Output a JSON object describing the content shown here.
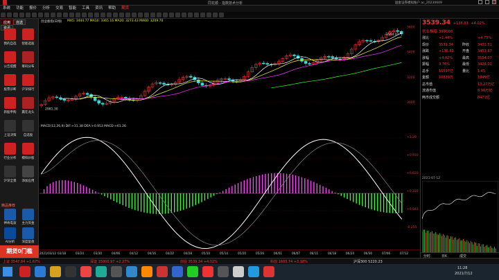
{
  "window": {
    "title": "同花顺 - 指数技术分析",
    "user": "国金证券模拟账户 ac_20230609"
  },
  "menu": {
    "items": [
      "系统",
      "功能",
      "报价",
      "分析",
      "交易",
      "智能",
      "工具",
      "资讯",
      "帮助",
      "期货"
    ]
  },
  "sidebar": {
    "tabs": [
      "应用",
      "自选",
      "资讯"
    ],
    "items": [
      {
        "label": "我的自选",
        "color": "#c22"
      },
      {
        "label": "智能选股",
        "color": "#c22"
      },
      {
        "label": "公告提醒",
        "color": "#c22"
      },
      {
        "label": "筹码分布",
        "color": "#a22"
      },
      {
        "label": "股票诊断",
        "color": "#c22"
      },
      {
        "label": "沪深排行",
        "color": "#c22"
      },
      {
        "label": "新股申购",
        "color": "#c22"
      },
      {
        "label": "赢在龙头",
        "color": "#a22"
      },
      {
        "label": "上证决策",
        "color": "#333"
      },
      {
        "label": "自选股",
        "color": "#333"
      },
      {
        "label": "行业分析",
        "color": "#c22"
      },
      {
        "label": "模拟炒股",
        "color": "#c22"
      },
      {
        "label": "沪深全景",
        "color": "#333"
      },
      {
        "label": "添加应用",
        "color": "#444"
      }
    ],
    "section": "精品推荐",
    "promo": [
      {
        "label": "神奇电波",
        "color": "#1a5aa8"
      },
      {
        "label": "主力资金",
        "color": "#1a5aa8"
      },
      {
        "label": "AI分析",
        "color": "#0a4a9a"
      },
      {
        "label": "深度复盘",
        "color": "#1a5aa8"
      }
    ],
    "ad": "期货0门槛"
  },
  "chart": {
    "header": "创业板指(日线)",
    "ma_line": "MA5: 3444.77  MA10: 3365.16  MA20: 3273.43  MA60: 3209.70",
    "macd_line": "MACD(12,26,9) DIF:+31.38 DEA:+0.953  MACD:+61.26",
    "k_high_label": "3554.07",
    "k_low_label": "2981.30",
    "k_scale": [
      "3600",
      "3400",
      "3200",
      "3000"
    ],
    "m_scale": [
      "+1.20",
      "+0.910",
      "+0.620",
      "+0.330",
      "+0.040",
      "-0.251"
    ],
    "dates": [
      "2021/03/12",
      "03/18",
      "03/24",
      "03/30",
      "04/06",
      "04/12",
      "04/16",
      "04/22",
      "04/28",
      "05/10",
      "05/14",
      "05/20",
      "05/26",
      "06/01",
      "06/07",
      "06/11",
      "06/18",
      "06/24",
      "06/30",
      "07/06",
      "07/12"
    ]
  },
  "quote": {
    "name": "创业板指",
    "code": "399006",
    "price": "3539.34",
    "change": "+136.83",
    "pct": "+4.02%",
    "rows": [
      [
        "涨比",
        "+1.44%",
        "",
        "+4.73%"
      ],
      [
        "现价",
        "3539.34",
        "昨收",
        "3402.51"
      ],
      [
        "涨跌",
        "+136.83",
        "开盘",
        "3453.87"
      ],
      [
        "涨幅",
        "+4.02%",
        "最高",
        "3554.07"
      ],
      [
        "振幅",
        "3.76%",
        "最低",
        "3426.01"
      ],
      [
        "总手",
        "16597亿",
        "量比",
        "1.45"
      ],
      [
        "金额",
        "10839万",
        "",
        "1945亿"
      ],
      [
        "总市值",
        "",
        "",
        "13.27万亿"
      ],
      [
        "流通市值",
        "",
        "",
        "8.96万亿"
      ],
      [
        "两市成交额",
        "",
        "",
        "8471亿"
      ]
    ],
    "mini_label": "2021-07-12",
    "footer": [
      "分时",
      "日K",
      "成交"
    ]
  },
  "bottom": {
    "items": [
      "上证 3547.84 +1.67%",
      "深证 15000.97 +2.27%",
      "创业 3539.34 +4.02%",
      "科创 1603.74 +3.18%",
      "沪深300 5220.23"
    ]
  },
  "clock": {
    "time": "11:28",
    "date": "2021/7/12"
  },
  "colors": {
    "up": "#ff3333",
    "down": "#33cc33",
    "bg": "#000000",
    "accent": "#d32222"
  }
}
